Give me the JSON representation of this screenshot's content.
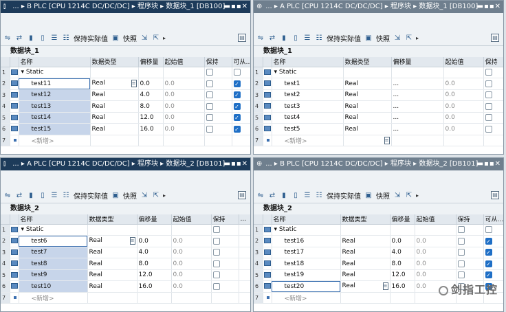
{
  "common": {
    "toolbar_keep_actual": "保持实际值",
    "toolbar_snapshot": "快照",
    "col_name": "名称",
    "col_datatype": "数据类型",
    "col_offset": "偏移量",
    "col_start": "起始值",
    "col_retain": "保持",
    "col_access": "可从…",
    "static_label": "Static",
    "new_row": "<新增>"
  },
  "panes": [
    {
      "title": "...  ▸ B PLC [CPU 1214C DC/DC/DC]  ▸  程序块  ▸  数据块_1 [DB100]",
      "block_name": "数据块_1",
      "col_access_label": "可从…",
      "rows": [
        {
          "num": "1",
          "name": "Static",
          "type": "",
          "offset": "",
          "start": ""
        },
        {
          "num": "2",
          "name": "test11",
          "type": "Real",
          "offset": "0.0",
          "start": "0.0",
          "retain": false,
          "access": true
        },
        {
          "num": "3",
          "name": "test12",
          "type": "Real",
          "offset": "4.0",
          "start": "0.0",
          "retain": false,
          "access": true
        },
        {
          "num": "4",
          "name": "test13",
          "type": "Real",
          "offset": "8.0",
          "start": "0.0",
          "retain": false,
          "access": true
        },
        {
          "num": "5",
          "name": "test14",
          "type": "Real",
          "offset": "12.0",
          "start": "0.0",
          "retain": false,
          "access": true
        },
        {
          "num": "6",
          "name": "test15",
          "type": "Real",
          "offset": "16.0",
          "start": "0.0",
          "retain": false,
          "access": true
        },
        {
          "num": "7",
          "name": "<新增>"
        }
      ]
    },
    {
      "title": "...  ▸ A PLC [CPU 1214C DC/DC/DC]  ▸  程序块  ▸  数据块_1 [DB100]",
      "block_name": "数据块_1",
      "col_access_label": "",
      "rows": [
        {
          "num": "1",
          "name": "Static",
          "type": "",
          "offset": "",
          "start": ""
        },
        {
          "num": "2",
          "name": "test1",
          "type": "Real",
          "offset": "...",
          "start": "0.0",
          "retain": false
        },
        {
          "num": "3",
          "name": "test2",
          "type": "Real",
          "offset": "...",
          "start": "0.0",
          "retain": false
        },
        {
          "num": "4",
          "name": "test3",
          "type": "Real",
          "offset": "...",
          "start": "0.0",
          "retain": false
        },
        {
          "num": "5",
          "name": "test4",
          "type": "Real",
          "offset": "...",
          "start": "0.0",
          "retain": false
        },
        {
          "num": "6",
          "name": "test5",
          "type": "Real",
          "offset": "...",
          "start": "0.0",
          "retain": false
        },
        {
          "num": "7",
          "name": "<新增>"
        }
      ]
    },
    {
      "title": "...  ▸ A PLC [CPU 1214C DC/DC/DC]  ▸  程序块  ▸  数据块_2 [DB101]",
      "block_name": "数据块_2",
      "col_access_label": "...",
      "rows": [
        {
          "num": "1",
          "name": "Static",
          "type": "",
          "offset": "",
          "start": ""
        },
        {
          "num": "2",
          "name": "test6",
          "type": "Real",
          "offset": "0.0",
          "start": "0.0",
          "retain": false
        },
        {
          "num": "3",
          "name": "test7",
          "type": "Real",
          "offset": "4.0",
          "start": "0.0",
          "retain": false
        },
        {
          "num": "4",
          "name": "test8",
          "type": "Real",
          "offset": "8.0",
          "start": "0.0",
          "retain": false
        },
        {
          "num": "5",
          "name": "test9",
          "type": "Real",
          "offset": "12.0",
          "start": "0.0",
          "retain": false
        },
        {
          "num": "6",
          "name": "test10",
          "type": "Real",
          "offset": "16.0",
          "start": "0.0",
          "retain": false
        },
        {
          "num": "7",
          "name": "<新增>"
        }
      ]
    },
    {
      "title": "...  ▸ B PLC [CPU 1214C DC/DC/DC]  ▸  程序块  ▸  数据块_2 [DB101]",
      "block_name": "数据块_2",
      "col_access_label": "可从…",
      "rows": [
        {
          "num": "1",
          "name": "Static",
          "type": "",
          "offset": "",
          "start": ""
        },
        {
          "num": "2",
          "name": "test16",
          "type": "Real",
          "offset": "0.0",
          "start": "0.0",
          "retain": false,
          "access": true
        },
        {
          "num": "3",
          "name": "test17",
          "type": "Real",
          "offset": "4.0",
          "start": "0.0",
          "retain": false,
          "access": true
        },
        {
          "num": "4",
          "name": "test18",
          "type": "Real",
          "offset": "8.0",
          "start": "0.0",
          "retain": false,
          "access": true
        },
        {
          "num": "5",
          "name": "test19",
          "type": "Real",
          "offset": "12.0",
          "start": "0.0",
          "retain": false,
          "access": true
        },
        {
          "num": "6",
          "name": "test20",
          "type": "Real",
          "offset": "16.0",
          "start": "0.0",
          "retain": false,
          "access": true
        },
        {
          "num": "7",
          "name": "<新增>"
        }
      ]
    }
  ],
  "watermark": "剑指工控",
  "colors": {
    "title_active": "#1d3b5a",
    "title_inactive": "#6f7f8e",
    "selection": "#c7d5ea",
    "checkbox_on": "#1f6fc6"
  }
}
